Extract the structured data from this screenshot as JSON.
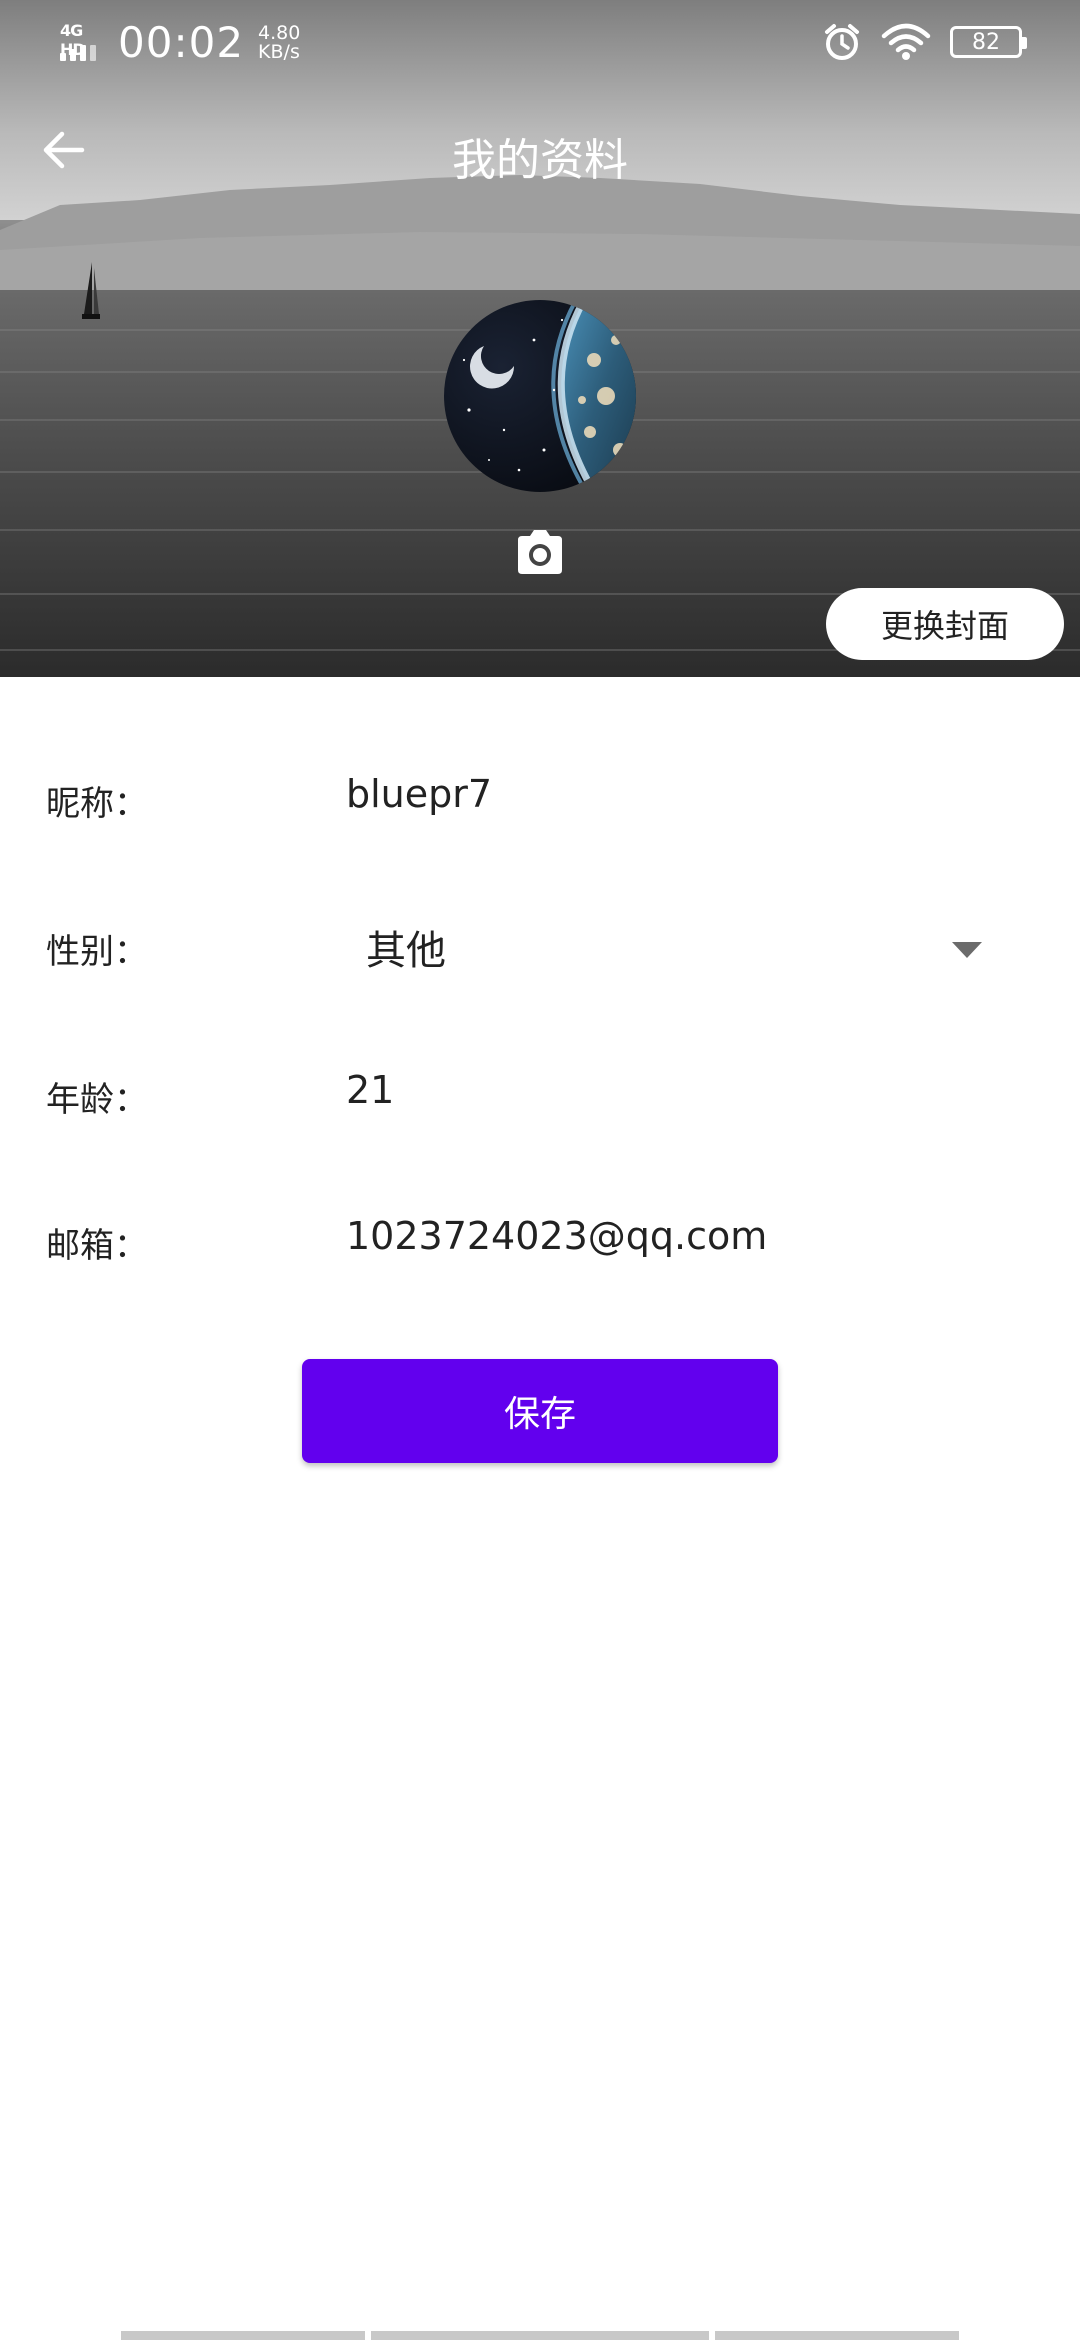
{
  "status_bar": {
    "network": "4G HD",
    "time": "00:02",
    "speed_value": "4.80",
    "speed_unit": "KB/s",
    "battery": "82",
    "icons": [
      "signal-icon",
      "alarm-icon",
      "wifi-icon",
      "battery-icon"
    ]
  },
  "header": {
    "title": "我的资料",
    "back_icon": "arrow-left-icon",
    "camera_icon": "camera-icon",
    "change_cover_label": "更换封面"
  },
  "form": {
    "nickname": {
      "label": "昵称：",
      "value": "bluepr7"
    },
    "gender": {
      "label": "性别：",
      "value": "其他"
    },
    "age": {
      "label": "年龄：",
      "value": "21"
    },
    "email": {
      "label": "邮箱：",
      "value": "1023724023@qq.com"
    }
  },
  "save_label": "保存",
  "colors": {
    "primary": "#6200ee",
    "text": "#222222",
    "background": "#ffffff"
  }
}
